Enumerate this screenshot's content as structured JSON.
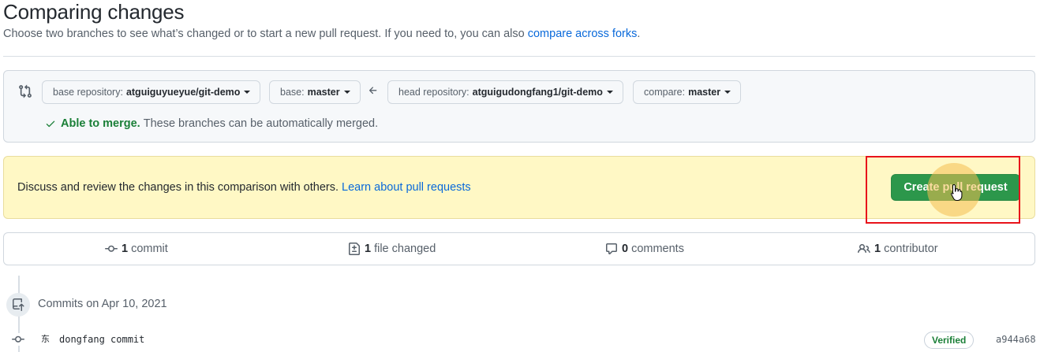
{
  "header": {
    "title": "Comparing changes",
    "subtitle_prefix": "Choose two branches to see what’s changed or to start a new pull request. If you need to, you can also",
    "subtitle_link": "compare across forks",
    "subtitle_suffix": "."
  },
  "range": {
    "base_repo_label": "base repository:",
    "base_repo_value": "atguiguyueyue/git-demo",
    "base_label": "base:",
    "base_value": "master",
    "head_repo_label": "head repository:",
    "head_repo_value": "atguigudongfang1/git-demo",
    "compare_label": "compare:",
    "compare_value": "master",
    "merge_status_strong": "Able to merge.",
    "merge_status_text": "These branches can be automatically merged."
  },
  "discuss": {
    "text": "Discuss and review the changes in this comparison with others.",
    "link": "Learn about pull requests",
    "button": "Create pull request"
  },
  "summary": {
    "commits_count": "1",
    "commits_label": "commit",
    "files_count": "1",
    "files_label": "file changed",
    "comments_count": "0",
    "comments_label": "comments",
    "contributors_count": "1",
    "contributors_label": "contributor"
  },
  "commits": {
    "heading": "Commits on Apr 10, 2021",
    "items": [
      {
        "avatar": "东",
        "message": "dongfang commit",
        "badge": "Verified",
        "sha": "a944a68"
      }
    ]
  },
  "colors": {
    "primary_button": "#2c974b",
    "flash_background": "#fff8c5",
    "highlight_border": "#e8131b",
    "link": "#0969da",
    "success": "#1a7f37"
  },
  "icons": [
    "git-compare-icon",
    "arrow-left-icon",
    "check-icon",
    "git-commit-icon",
    "file-diff-icon",
    "comment-icon",
    "people-icon",
    "repo-push-icon",
    "hand-pointer-cursor-icon"
  ]
}
